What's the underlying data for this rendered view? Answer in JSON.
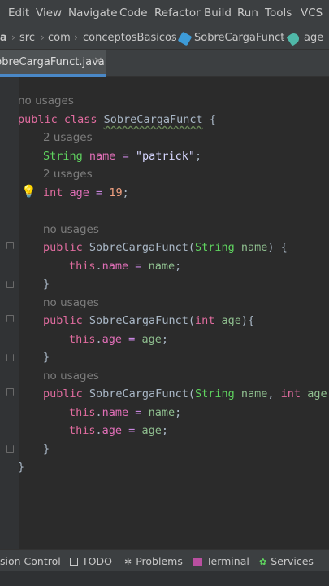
{
  "menu": {
    "items": [
      "Edit",
      "View",
      "Navigate",
      "Code",
      "Refactor",
      "Build",
      "Run",
      "Tools",
      "VCS"
    ]
  },
  "breadcrumb": {
    "items": [
      "a",
      "src",
      "com",
      "conceptosBasicos",
      "SobreCargaFunct",
      "age"
    ]
  },
  "tab": {
    "label": "SobreCargaFunct.java",
    "close": "×"
  },
  "code": {
    "hint_l1": "no usages",
    "l2_kw": "public class ",
    "l2_class": "SobreCargaFunct",
    "l2_brace": " {",
    "hint_l3": "2 usages",
    "l4_type": "String",
    "l4_field": "name",
    "l4_eq": " = ",
    "l4_str": "\"patrick\"",
    "l4_end": ";",
    "hint_l5": "2 usages",
    "l6_kw": "int",
    "l6_field": "age",
    "l6_eq": " = ",
    "l6_num": "19",
    "l6_end": ";",
    "hint_l8": "no usages",
    "l9_kw": "public",
    "l9_name": " SobreCargaFunct(",
    "l9_type": "String",
    "l9_param": "name",
    "l9_end": ") {",
    "l10_this": "this",
    "l10_dot": ".",
    "l10_field": "name",
    "l10_eq": " = ",
    "l10_param": "name",
    "l10_end": ";",
    "l11": "}",
    "hint_l12": "no usages",
    "l13_kw": "public",
    "l13_name": " SobreCargaFunct(",
    "l13_type": "int",
    "l13_param": "age",
    "l13_end": "){",
    "l14_this": "this",
    "l14_dot": ".",
    "l14_field": "age",
    "l14_eq": " = ",
    "l14_param": "age",
    "l14_end": ";",
    "l15": "}",
    "hint_l16": "no usages",
    "l17_kw": "public",
    "l17_name": " SobreCargaFunct(",
    "l17_type1": "String",
    "l17_param1": "name",
    "l17_comma": ", ",
    "l17_type2": "int",
    "l17_param2": "age",
    "l17_end": ")",
    "l18_this": "this",
    "l18_dot": ".",
    "l18_field": "name",
    "l18_eq": " = ",
    "l18_param": "name",
    "l18_end": ";",
    "l19_this": "this",
    "l19_dot": ".",
    "l19_field": "age",
    "l19_eq": " = ",
    "l19_param": "age",
    "l19_end": ";",
    "l20": "}",
    "l21": "}"
  },
  "toolwindows": {
    "version_control": "sion Control",
    "todo": "TODO",
    "problems": "Problems",
    "terminal": "Terminal",
    "services": "Services"
  },
  "colors": {
    "background": "#2b2b2b",
    "chrome": "#3c3f41",
    "accent": "#4a88c7",
    "bulb": "#f2d33a"
  }
}
